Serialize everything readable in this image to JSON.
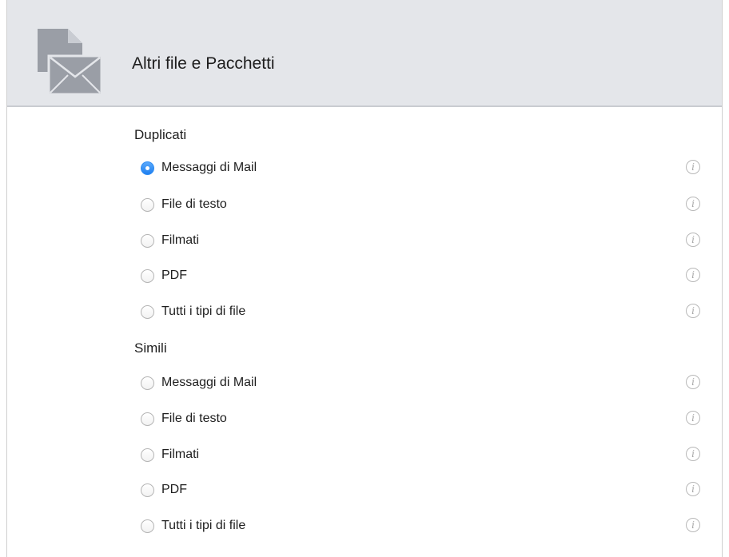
{
  "header": {
    "title": "Altri file e Pacchetti",
    "icon": "document-mail-icon"
  },
  "sections": [
    {
      "label": "Duplicati",
      "options": [
        {
          "label": "Messaggi di Mail",
          "checked": true
        },
        {
          "label": "File di testo",
          "checked": false
        },
        {
          "label": "Filmati",
          "checked": false
        },
        {
          "label": "PDF",
          "checked": false
        },
        {
          "label": "Tutti i tipi di file",
          "checked": false
        }
      ]
    },
    {
      "label": "Simili",
      "options": [
        {
          "label": "Messaggi di Mail",
          "checked": false
        },
        {
          "label": "File di testo",
          "checked": false
        },
        {
          "label": "Filmati",
          "checked": false
        },
        {
          "label": "PDF",
          "checked": false
        },
        {
          "label": "Tutti i tipi di file",
          "checked": false
        }
      ]
    }
  ],
  "info_glyph": "i",
  "colors": {
    "accent": "#2d8cf4",
    "header_bg": "#e4e6ea",
    "icon_gray": "#9a9ea6"
  }
}
